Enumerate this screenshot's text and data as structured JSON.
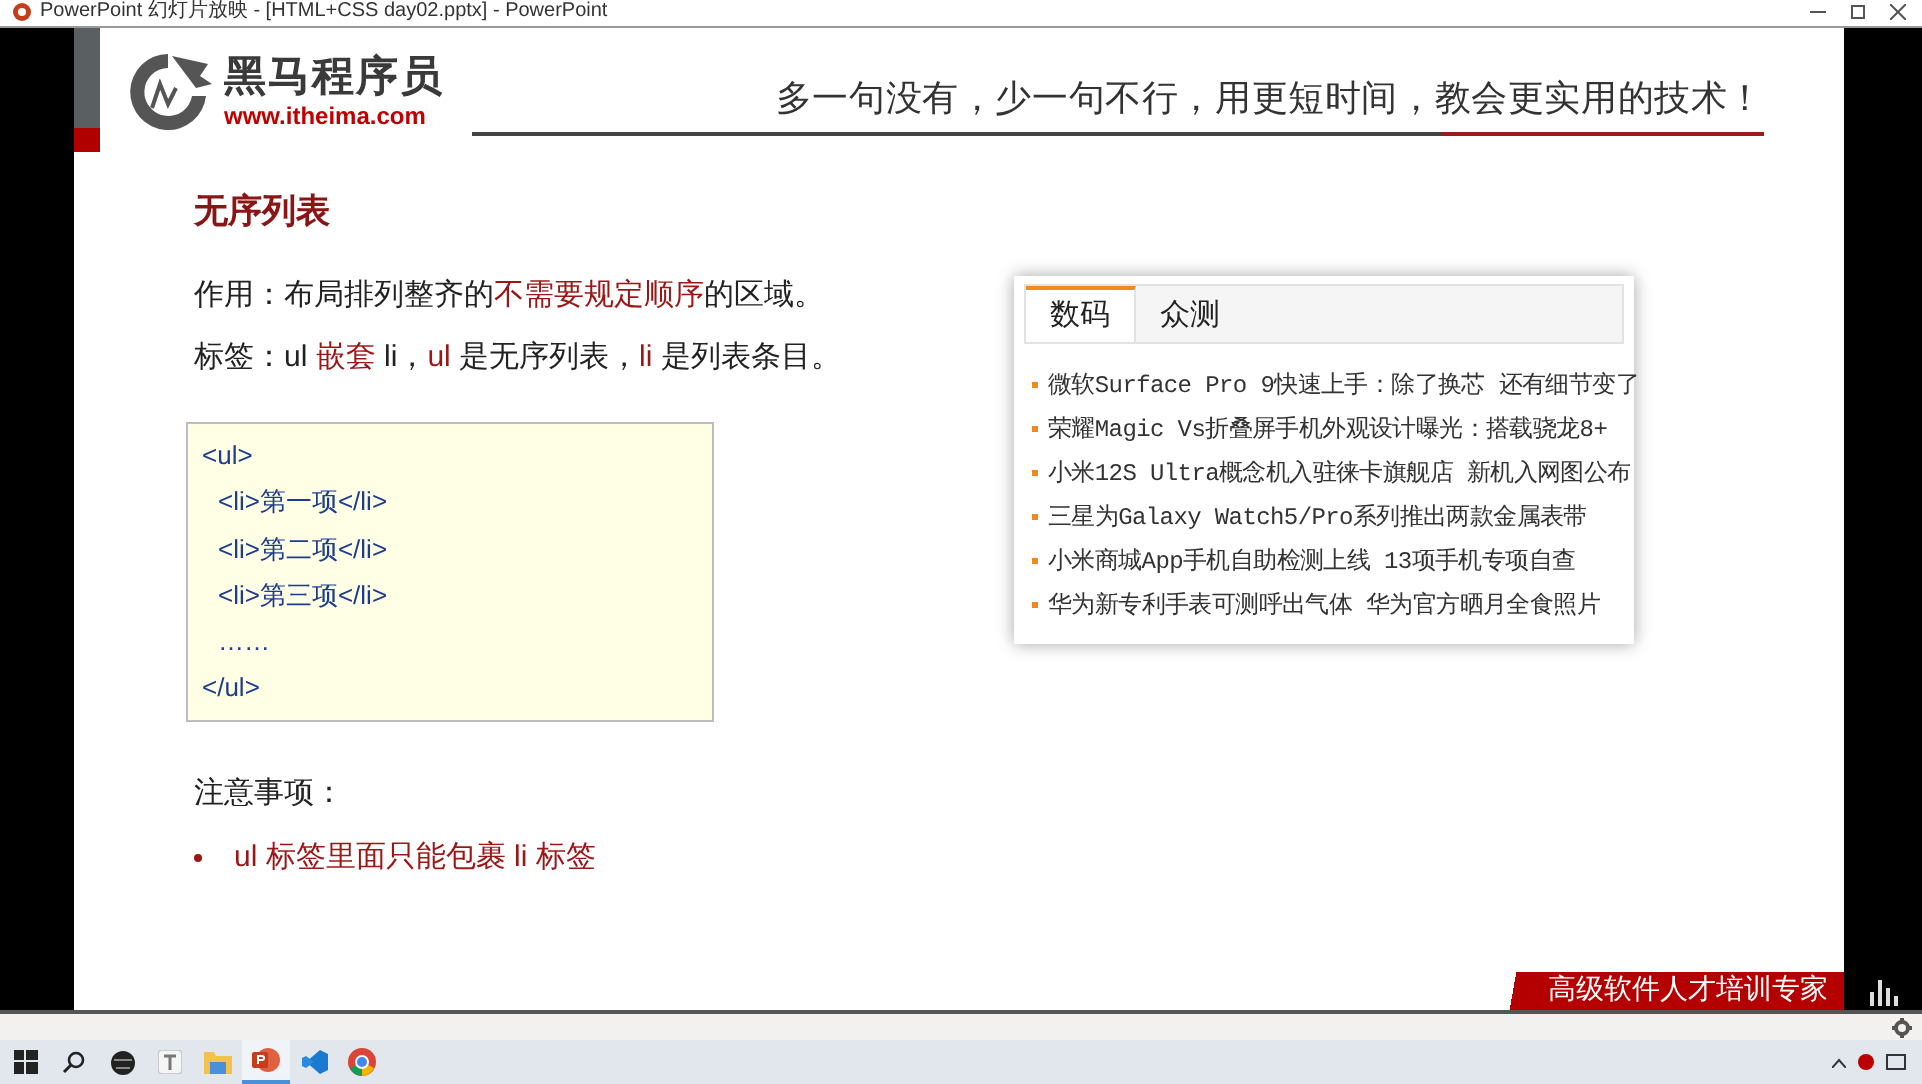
{
  "window": {
    "title": "PowerPoint 幻灯片放映 - [HTML+CSS day02.pptx] - PowerPoint"
  },
  "slide": {
    "logo": {
      "name": "黑马程序员",
      "url": "www.itheima.com"
    },
    "slogan": "多一句没有，少一句不行，用更短时间，教会更实用的技术！",
    "heading": "无序列表",
    "paragraphs": [
      [
        {
          "text": "作用：布局排列整齐的",
          "emphasis": false
        },
        {
          "text": "不需要规定顺序",
          "emphasis": true
        },
        {
          "text": "的区域。",
          "emphasis": false
        }
      ],
      [
        {
          "text": "标签：ul ",
          "emphasis": false
        },
        {
          "text": "嵌套",
          "emphasis": true
        },
        {
          "text": " li，",
          "emphasis": false
        },
        {
          "text": "ul",
          "emphasis": true
        },
        {
          "text": " 是无序列表，",
          "emphasis": false
        },
        {
          "text": "li",
          "emphasis": true
        },
        {
          "text": " 是列表条目。",
          "emphasis": false
        }
      ]
    ],
    "code_lines": [
      {
        "text": "<ul>",
        "indented": false
      },
      {
        "text": "<li>第一项</li>",
        "indented": true
      },
      {
        "text": "<li>第二项</li>",
        "indented": true
      },
      {
        "text": "<li>第三项</li>",
        "indented": true
      },
      {
        "text": "……",
        "indented": true
      },
      {
        "text": "</ul>",
        "indented": false
      }
    ],
    "notes_title": "注意事项：",
    "notes": [
      "ul 标签里面只能包裹 li 标签"
    ],
    "news_widget": {
      "tabs": [
        {
          "label": "数码",
          "selected": true
        },
        {
          "label": "众测",
          "selected": false
        }
      ],
      "items": [
        "微软Surface Pro 9快速上手：除了换芯 还有细节变了",
        "荣耀Magic Vs折叠屏手机外观设计曝光：搭载骁龙8+",
        "小米12S Ultra概念机入驻徕卡旗舰店 新机入网图公布",
        "三星为Galaxy Watch5/Pro系列推出两款金属表带",
        "小米商城App手机自助检测上线 13项手机专项自查",
        "华为新专利手表可测呼出气体 华为官方晒月全食照片"
      ]
    },
    "banner": "高级软件人才培训专家"
  },
  "taskbar": {
    "apps": [
      {
        "kind": "start",
        "active": false
      },
      {
        "kind": "search",
        "active": false
      },
      {
        "kind": "globe",
        "active": false
      },
      {
        "kind": "text",
        "active": false
      },
      {
        "kind": "folder",
        "active": false
      },
      {
        "kind": "slides",
        "active": true
      },
      {
        "kind": "code",
        "active": false
      },
      {
        "kind": "browser",
        "active": false
      }
    ]
  }
}
